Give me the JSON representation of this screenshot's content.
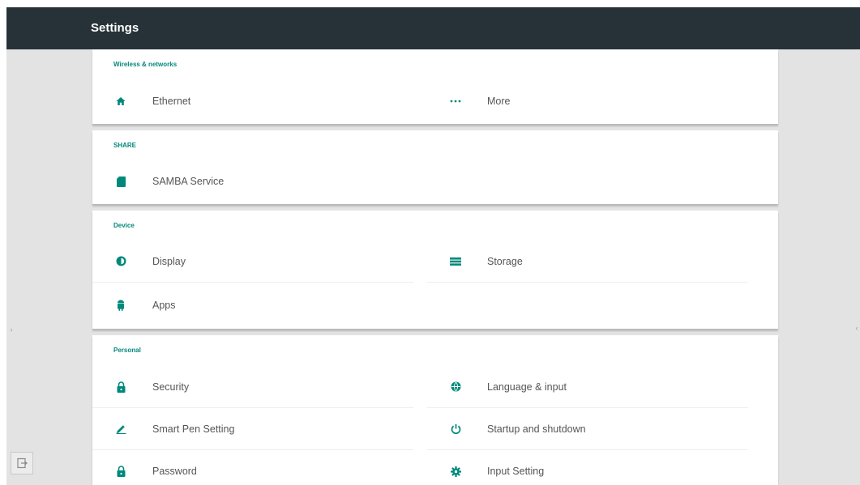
{
  "header": {
    "title": "Settings"
  },
  "sections": [
    {
      "title": "Wireless & networks",
      "items": [
        {
          "label": "Ethernet",
          "icon": "home-icon"
        },
        {
          "label": "More",
          "icon": "more-dots-icon"
        }
      ]
    },
    {
      "title": "SHARE",
      "items": [
        {
          "label": "SAMBA Service",
          "icon": "sd-card-icon"
        }
      ]
    },
    {
      "title": "Device",
      "items": [
        {
          "label": "Display",
          "icon": "brightness-icon"
        },
        {
          "label": "Storage",
          "icon": "storage-icon"
        },
        {
          "label": "Apps",
          "icon": "android-icon"
        }
      ]
    },
    {
      "title": "Personal",
      "items": [
        {
          "label": "Security",
          "icon": "lock-icon"
        },
        {
          "label": "Language & input",
          "icon": "globe-icon"
        },
        {
          "label": "Smart Pen Setting",
          "icon": "pen-icon"
        },
        {
          "label": "Startup and shutdown",
          "icon": "power-icon"
        },
        {
          "label": "Password",
          "icon": "lock-icon"
        },
        {
          "label": "Input Setting",
          "icon": "gear-icon"
        }
      ]
    }
  ],
  "colors": {
    "accent": "#00897b",
    "toolbar": "#263238",
    "background": "#e3e3e3"
  }
}
